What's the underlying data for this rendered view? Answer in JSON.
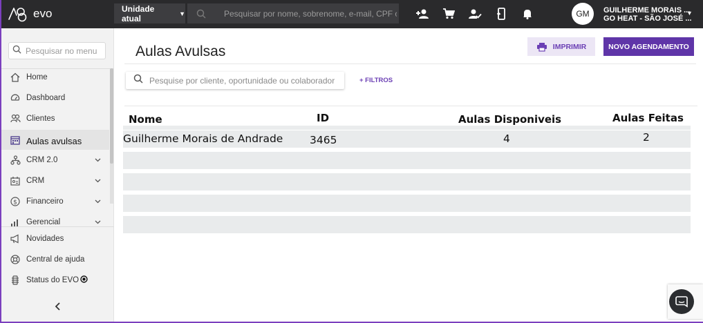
{
  "app": {
    "logo_text": "evo"
  },
  "topbar": {
    "unit_select": "Unidade atual",
    "search_placeholder": "Pesquisar por nome, sobrenome, e-mail, CPF ou cartão",
    "icons": [
      "person-add-icon",
      "cart-icon",
      "user-check-icon",
      "mobile-sync-icon",
      "bell-icon"
    ],
    "user_initials": "GM",
    "user_name": "GUILHERME MORAIS ...",
    "user_unit": "GO HEAT - SÃO JOSÉ ..."
  },
  "sidebar": {
    "search_placeholder": "Pesquisar no menu",
    "items": [
      {
        "label": "Home",
        "icon": "home-icon",
        "expandable": false,
        "active": false
      },
      {
        "label": "Dashboard",
        "icon": "dashboard-icon",
        "expandable": false,
        "active": false
      },
      {
        "label": "Clientes",
        "icon": "clients-icon",
        "expandable": false,
        "active": false
      },
      {
        "label": "Aulas avulsas",
        "icon": "calendar-icon",
        "expandable": false,
        "active": true
      },
      {
        "label": "CRM 2.0",
        "icon": "crm2-icon",
        "expandable": true,
        "active": false
      },
      {
        "label": "CRM",
        "icon": "crm-icon",
        "expandable": true,
        "active": false
      },
      {
        "label": "Financeiro",
        "icon": "dollar-icon",
        "expandable": true,
        "active": false
      },
      {
        "label": "Gerencial",
        "icon": "bar-chart-icon",
        "expandable": true,
        "active": false
      }
    ],
    "bottom_items": [
      {
        "label": "Novidades",
        "icon": "megaphone-icon"
      },
      {
        "label": "Central de ajuda",
        "icon": "lifebuoy-icon"
      },
      {
        "label": "Status do EVO",
        "icon": "status-icon"
      }
    ]
  },
  "main": {
    "title": "Aulas Avulsas",
    "print_label": "IMPRIMIR",
    "new_label": "NOVO AGENDAMENTO",
    "search_placeholder": "Pesquise por cliente, oportunidade ou colaborador",
    "filters_label": "+ FILTROS",
    "table": {
      "headers": [
        "Nome",
        "ID",
        "Aulas Disponiveis",
        "Aulas Feitas"
      ],
      "rows": [
        {
          "nome": "Guilherme Morais de Andrade",
          "id": "3465",
          "disponiveis": "4",
          "feitas": "2"
        }
      ],
      "empty_rows": 4
    }
  },
  "colors": {
    "accent": "#5f35a8",
    "accent_light": "#ece6f5",
    "topbar": "#2a2a2c",
    "row": "#e9ebec"
  }
}
